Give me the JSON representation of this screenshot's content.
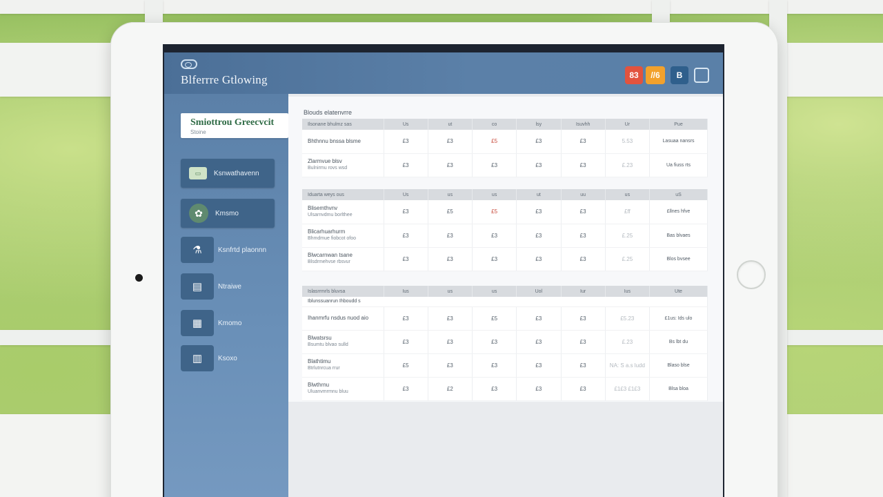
{
  "app": {
    "title": "Blferrre Gtlowing"
  },
  "header": {
    "buttons": [
      {
        "label": "83",
        "color": "#e2533e"
      },
      {
        "label": "//6",
        "color": "#f2a12c"
      },
      {
        "label": "B",
        "color": "#2f5f8c"
      },
      {
        "label": "",
        "color": "#d8e6f2"
      }
    ]
  },
  "sidebar": {
    "brand": {
      "name": "Smiottrou Greecvcit",
      "sub": "Stoine"
    },
    "items": [
      {
        "label": "Ksnwathavenn",
        "icon": "card-icon"
      },
      {
        "label": "Kmsmo",
        "icon": "gear-badge-icon"
      },
      {
        "label": "Ksnfrtd plaonnn",
        "icon": "bottle-icon"
      },
      {
        "label": "Ntraiwe",
        "icon": "screen-icon"
      },
      {
        "label": "Kmomo",
        "icon": "document-icon"
      },
      {
        "label": "Ksoxo",
        "icon": "chart-icon"
      }
    ]
  },
  "content": {
    "section_title": "Blouds elatenvrre",
    "tables": [
      {
        "header": [
          "Ilsonane bhulmz sas",
          "Us",
          "ut",
          "co",
          "lsy",
          "Isuvhh",
          "Ur",
          "Pue"
        ],
        "rows": [
          {
            "item": "Bhthnnu bnssa blsme",
            "cells": [
              "£3",
              "£3",
              "£5",
              "£3",
              "£3",
              "5.53",
              "Lasuaa nansrs"
            ]
          },
          {
            "item": "Zlarmvue blsv",
            "sub": "Bulnirmu rovs wsd",
            "cells": [
              "£3",
              "£3",
              "£3",
              "£3",
              "£3",
              "£.23",
              "Ua fiuss rts"
            ]
          }
        ]
      },
      {
        "header": [
          "Iduarta weys ous",
          "Us",
          "us",
          "us",
          "ut",
          "uu",
          "us",
          "uS"
        ],
        "rows": [
          {
            "item": "Blisemthvnv",
            "sub": "Ulsarnvdmu borlthee",
            "cells": [
              "£3",
              "£5",
              "£5",
              "£3",
              "£3",
              "£ff",
              "£llnes hfve"
            ]
          },
          {
            "item": "Blicarhuarhurm",
            "sub": "Bhmdmue fiobcot ofoo",
            "cells": [
              "£3",
              "£3",
              "£3",
              "£3",
              "£3",
              "£.25",
              "Bas blvaes"
            ]
          },
          {
            "item": "Blwcarnwan tsane",
            "sub": "Blsdrmehvse rbsvur",
            "cells": [
              "£3",
              "£3",
              "£3",
              "£3",
              "£3",
              "£.25",
              "Blos bvsee"
            ]
          }
        ]
      },
      {
        "header": [
          "Islasrrmrls bluvsa",
          "Ius",
          "us",
          "us",
          "Uol",
          "Iur",
          "Ius",
          "Ute"
        ],
        "subhead": "Iblunssuanrun Ihboudd s",
        "rows": [
          {
            "item": "Ihanmrfu nsdus nuod aio",
            "cells": [
              "£3",
              "£3",
              "£5",
              "£3",
              "£3",
              "£5.23",
              "£1us: Ids ulo"
            ]
          },
          {
            "item": "Blwatsrsu",
            "sub": "Bsumtu blvao sulld",
            "cells": [
              "£3",
              "£3",
              "£3",
              "£3",
              "£3",
              "£.23",
              "Bs lbt du"
            ]
          },
          {
            "item": "Blathtimu",
            "sub": "Btrlutnrcua rrur",
            "cells": [
              "£5",
              "£3",
              "£3",
              "£3",
              "£3",
              "NA: S a.s ludd",
              "Blaso blse"
            ]
          },
          {
            "item": "Blwthrnu",
            "sub": "Uluanvmrmnu bluu",
            "cells": [
              "£3",
              "£2",
              "£3",
              "£3",
              "£3",
              "£1£3 £1£3",
              "Blsa bloa"
            ]
          }
        ]
      }
    ]
  }
}
